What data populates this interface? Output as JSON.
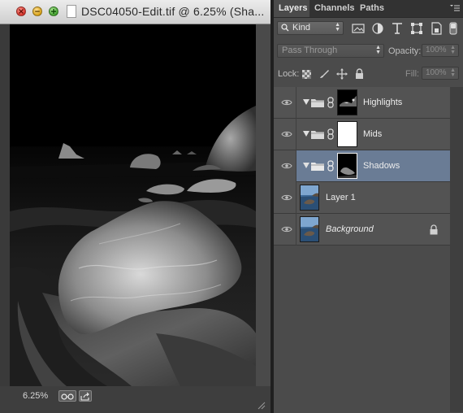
{
  "document": {
    "title": "DSC04050-Edit.tif @ 6.25% (Sha...",
    "zoom": "6.25%"
  },
  "panel": {
    "tabs": [
      "Layers",
      "Channels",
      "Paths"
    ],
    "active_tab": "Layers",
    "filter": {
      "kind_label": "Kind"
    },
    "blend_mode": "Pass Through",
    "opacity_label": "Opacity:",
    "opacity_value": "100%",
    "lock_label": "Lock:",
    "fill_label": "Fill:",
    "fill_value": "100%"
  },
  "layers": [
    {
      "name": "Highlights",
      "type": "group",
      "mask": "highlights-mask",
      "selected": false,
      "visible": true
    },
    {
      "name": "Mids",
      "type": "group",
      "mask": "white",
      "selected": false,
      "visible": true
    },
    {
      "name": "Shadows",
      "type": "group",
      "mask": "shadows-mask",
      "selected": true,
      "visible": true
    },
    {
      "name": "Layer 1",
      "type": "pixel",
      "selected": false,
      "visible": true
    },
    {
      "name": "Background",
      "type": "background",
      "locked": true,
      "selected": false,
      "visible": true
    }
  ],
  "colors": {
    "selected_layer": "#6a7c95",
    "panel_bg": "#4b4b4b",
    "canvas_bg": "#000000"
  }
}
